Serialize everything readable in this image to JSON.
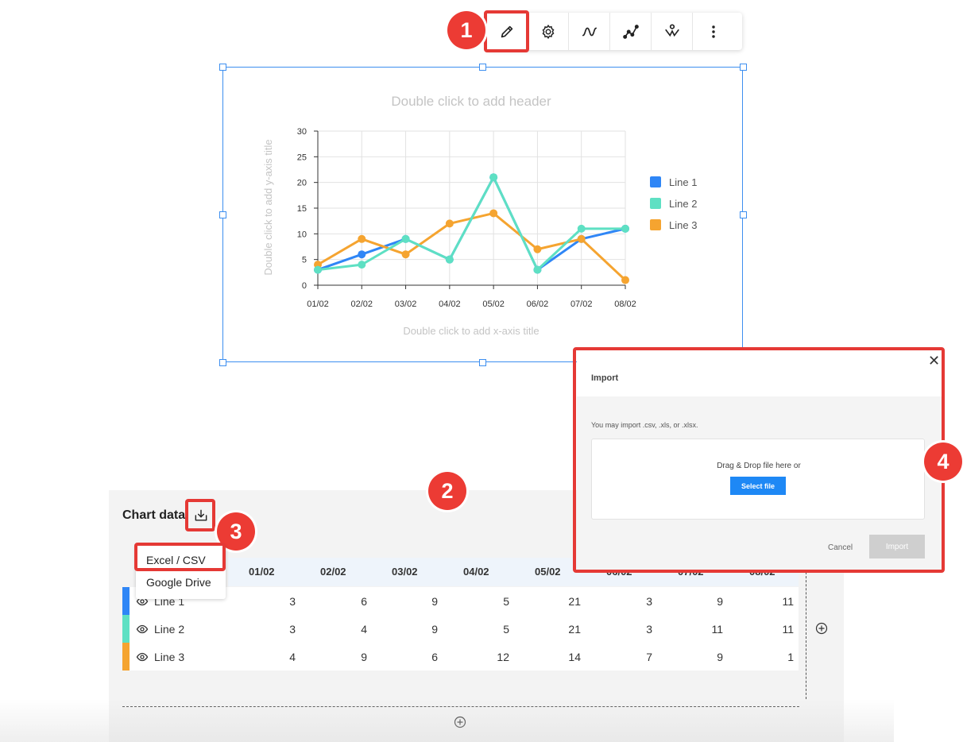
{
  "toolbar": {
    "buttons": [
      {
        "icon": "pencil-icon"
      },
      {
        "icon": "gear-icon"
      },
      {
        "icon": "curve-icon"
      },
      {
        "icon": "line-points-icon"
      },
      {
        "icon": "chart-type-icon"
      },
      {
        "icon": "more-vertical-icon"
      }
    ]
  },
  "badges": [
    "1",
    "2",
    "3",
    "4"
  ],
  "chart_data": {
    "type": "line",
    "title": "Double click to add header",
    "xlabel": "Double click to add x-axis title",
    "ylabel": "Double click to add y-axis title",
    "categories": [
      "01/02",
      "02/02",
      "03/02",
      "04/02",
      "05/02",
      "06/02",
      "07/02",
      "08/02"
    ],
    "ylim": [
      0,
      30
    ],
    "yticks": [
      0,
      5,
      10,
      15,
      20,
      25,
      30
    ],
    "grid": true,
    "legend": "right",
    "series": [
      {
        "name": "Line 1",
        "color": "#2f86f6",
        "values": [
          3,
          6,
          9,
          5,
          21,
          3,
          9,
          11
        ]
      },
      {
        "name": "Line 2",
        "color": "#5ee0c3",
        "values": [
          3,
          4,
          9,
          5,
          21,
          3,
          11,
          11
        ]
      },
      {
        "name": "Line 3",
        "color": "#f5a430",
        "values": [
          4,
          9,
          6,
          12,
          14,
          7,
          9,
          1
        ]
      }
    ]
  },
  "panel": {
    "title": "Chart data",
    "menu": [
      "Excel / CSV",
      "Google Drive"
    ],
    "columns": [
      "01/02",
      "02/02",
      "03/02",
      "04/02",
      "05/02",
      "06/02",
      "07/02",
      "08/02"
    ],
    "rows": [
      {
        "name": "Line 1",
        "color": "#2f86f6",
        "values": [
          "3",
          "6",
          "9",
          "5",
          "21",
          "3",
          "9",
          "11"
        ]
      },
      {
        "name": "Line 2",
        "color": "#5ee0c3",
        "values": [
          "3",
          "4",
          "9",
          "5",
          "21",
          "3",
          "11",
          "11"
        ]
      },
      {
        "name": "Line 3",
        "color": "#f5a430",
        "values": [
          "4",
          "9",
          "6",
          "12",
          "14",
          "7",
          "9",
          "1"
        ]
      }
    ]
  },
  "dialog": {
    "title": "Import",
    "close": "✕",
    "hint": "You may import .csv, .xls, or .xlsx.",
    "drop_text": "Drag & Drop file here or",
    "select_label": "Select file",
    "cancel_label": "Cancel",
    "import_label": "Import"
  },
  "colors": {
    "highlight": "#e53935",
    "badge": "#ec3b34",
    "selection": "#3d8ff0",
    "primary": "#1e88f5"
  }
}
